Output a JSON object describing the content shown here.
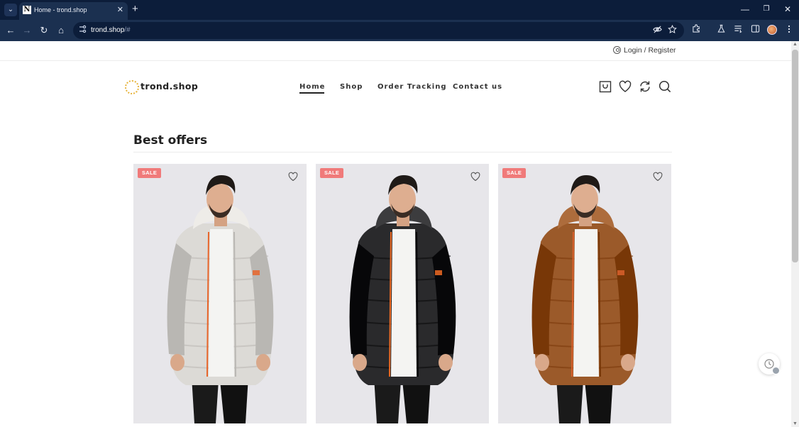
{
  "browser": {
    "tab_title": "Home - trond.shop",
    "favicon_letter": "N",
    "url_host": "trond.shop",
    "url_rest": "/#",
    "tab_close": "✕",
    "new_tab": "+",
    "window_controls": {
      "minimize": "—",
      "restore": "❐",
      "close": "✕"
    },
    "nav_icons": {
      "back": "←",
      "forward": "→",
      "reload": "↻",
      "home": "⌂"
    },
    "toolbar_icons": [
      "eye-off-icon",
      "star-icon",
      "extensions-icon",
      "labs-icon",
      "reading-list-icon",
      "side-panel-icon",
      "profile-avatar",
      "menu-icon"
    ]
  },
  "header": {
    "login_label": "Login / Register",
    "logo_text": "trond.shop",
    "nav": [
      {
        "label": "Home",
        "active": true
      },
      {
        "label": "Shop",
        "active": false
      },
      {
        "label": "Order Tracking",
        "active": false
      },
      {
        "label": "Contact us",
        "active": false
      }
    ],
    "icons": [
      "cart-icon",
      "wishlist-icon",
      "compare-icon",
      "search-icon"
    ]
  },
  "main": {
    "section_title": "Best offers",
    "products": [
      {
        "badge": "SALE",
        "jacket_color": "#dcdad6",
        "trim_color": "#e8652a"
      },
      {
        "badge": "SALE",
        "jacket_color": "#2a2a2c",
        "trim_color": "#ee6a23"
      },
      {
        "badge": "SALE",
        "jacket_color": "#9b5a2a",
        "trim_color": "#d9602c"
      }
    ]
  },
  "colors": {
    "browser_dark": "#0c1d3a",
    "browser_toolbar": "#1b3050",
    "sale_badge": "#f07a7a",
    "text_dark": "#222222"
  }
}
